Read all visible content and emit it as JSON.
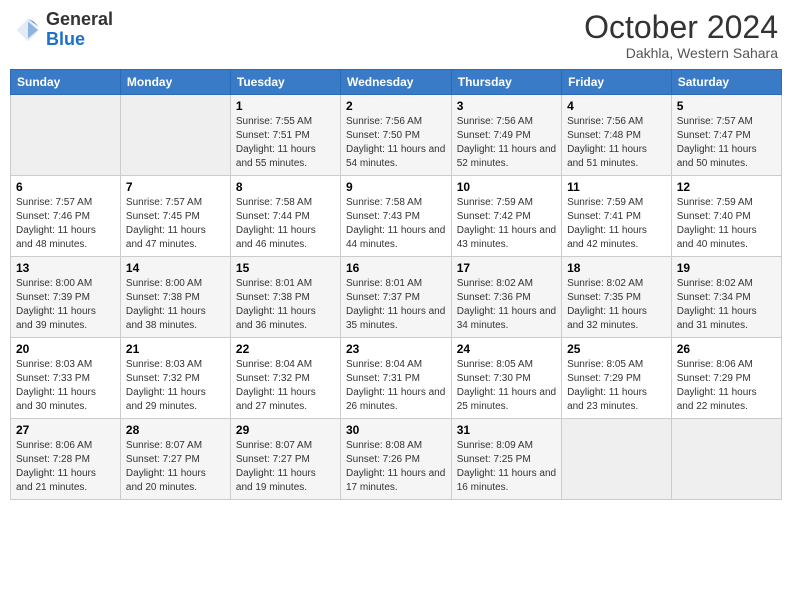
{
  "header": {
    "logo_general": "General",
    "logo_blue": "Blue",
    "month_title": "October 2024",
    "location": "Dakhla, Western Sahara"
  },
  "days_of_week": [
    "Sunday",
    "Monday",
    "Tuesday",
    "Wednesday",
    "Thursday",
    "Friday",
    "Saturday"
  ],
  "weeks": [
    [
      {
        "day": "",
        "sunrise": "",
        "sunset": "",
        "daylight": ""
      },
      {
        "day": "",
        "sunrise": "",
        "sunset": "",
        "daylight": ""
      },
      {
        "day": "1",
        "sunrise": "Sunrise: 7:55 AM",
        "sunset": "Sunset: 7:51 PM",
        "daylight": "Daylight: 11 hours and 55 minutes."
      },
      {
        "day": "2",
        "sunrise": "Sunrise: 7:56 AM",
        "sunset": "Sunset: 7:50 PM",
        "daylight": "Daylight: 11 hours and 54 minutes."
      },
      {
        "day": "3",
        "sunrise": "Sunrise: 7:56 AM",
        "sunset": "Sunset: 7:49 PM",
        "daylight": "Daylight: 11 hours and 52 minutes."
      },
      {
        "day": "4",
        "sunrise": "Sunrise: 7:56 AM",
        "sunset": "Sunset: 7:48 PM",
        "daylight": "Daylight: 11 hours and 51 minutes."
      },
      {
        "day": "5",
        "sunrise": "Sunrise: 7:57 AM",
        "sunset": "Sunset: 7:47 PM",
        "daylight": "Daylight: 11 hours and 50 minutes."
      }
    ],
    [
      {
        "day": "6",
        "sunrise": "Sunrise: 7:57 AM",
        "sunset": "Sunset: 7:46 PM",
        "daylight": "Daylight: 11 hours and 48 minutes."
      },
      {
        "day": "7",
        "sunrise": "Sunrise: 7:57 AM",
        "sunset": "Sunset: 7:45 PM",
        "daylight": "Daylight: 11 hours and 47 minutes."
      },
      {
        "day": "8",
        "sunrise": "Sunrise: 7:58 AM",
        "sunset": "Sunset: 7:44 PM",
        "daylight": "Daylight: 11 hours and 46 minutes."
      },
      {
        "day": "9",
        "sunrise": "Sunrise: 7:58 AM",
        "sunset": "Sunset: 7:43 PM",
        "daylight": "Daylight: 11 hours and 44 minutes."
      },
      {
        "day": "10",
        "sunrise": "Sunrise: 7:59 AM",
        "sunset": "Sunset: 7:42 PM",
        "daylight": "Daylight: 11 hours and 43 minutes."
      },
      {
        "day": "11",
        "sunrise": "Sunrise: 7:59 AM",
        "sunset": "Sunset: 7:41 PM",
        "daylight": "Daylight: 11 hours and 42 minutes."
      },
      {
        "day": "12",
        "sunrise": "Sunrise: 7:59 AM",
        "sunset": "Sunset: 7:40 PM",
        "daylight": "Daylight: 11 hours and 40 minutes."
      }
    ],
    [
      {
        "day": "13",
        "sunrise": "Sunrise: 8:00 AM",
        "sunset": "Sunset: 7:39 PM",
        "daylight": "Daylight: 11 hours and 39 minutes."
      },
      {
        "day": "14",
        "sunrise": "Sunrise: 8:00 AM",
        "sunset": "Sunset: 7:38 PM",
        "daylight": "Daylight: 11 hours and 38 minutes."
      },
      {
        "day": "15",
        "sunrise": "Sunrise: 8:01 AM",
        "sunset": "Sunset: 7:38 PM",
        "daylight": "Daylight: 11 hours and 36 minutes."
      },
      {
        "day": "16",
        "sunrise": "Sunrise: 8:01 AM",
        "sunset": "Sunset: 7:37 PM",
        "daylight": "Daylight: 11 hours and 35 minutes."
      },
      {
        "day": "17",
        "sunrise": "Sunrise: 8:02 AM",
        "sunset": "Sunset: 7:36 PM",
        "daylight": "Daylight: 11 hours and 34 minutes."
      },
      {
        "day": "18",
        "sunrise": "Sunrise: 8:02 AM",
        "sunset": "Sunset: 7:35 PM",
        "daylight": "Daylight: 11 hours and 32 minutes."
      },
      {
        "day": "19",
        "sunrise": "Sunrise: 8:02 AM",
        "sunset": "Sunset: 7:34 PM",
        "daylight": "Daylight: 11 hours and 31 minutes."
      }
    ],
    [
      {
        "day": "20",
        "sunrise": "Sunrise: 8:03 AM",
        "sunset": "Sunset: 7:33 PM",
        "daylight": "Daylight: 11 hours and 30 minutes."
      },
      {
        "day": "21",
        "sunrise": "Sunrise: 8:03 AM",
        "sunset": "Sunset: 7:32 PM",
        "daylight": "Daylight: 11 hours and 29 minutes."
      },
      {
        "day": "22",
        "sunrise": "Sunrise: 8:04 AM",
        "sunset": "Sunset: 7:32 PM",
        "daylight": "Daylight: 11 hours and 27 minutes."
      },
      {
        "day": "23",
        "sunrise": "Sunrise: 8:04 AM",
        "sunset": "Sunset: 7:31 PM",
        "daylight": "Daylight: 11 hours and 26 minutes."
      },
      {
        "day": "24",
        "sunrise": "Sunrise: 8:05 AM",
        "sunset": "Sunset: 7:30 PM",
        "daylight": "Daylight: 11 hours and 25 minutes."
      },
      {
        "day": "25",
        "sunrise": "Sunrise: 8:05 AM",
        "sunset": "Sunset: 7:29 PM",
        "daylight": "Daylight: 11 hours and 23 minutes."
      },
      {
        "day": "26",
        "sunrise": "Sunrise: 8:06 AM",
        "sunset": "Sunset: 7:29 PM",
        "daylight": "Daylight: 11 hours and 22 minutes."
      }
    ],
    [
      {
        "day": "27",
        "sunrise": "Sunrise: 8:06 AM",
        "sunset": "Sunset: 7:28 PM",
        "daylight": "Daylight: 11 hours and 21 minutes."
      },
      {
        "day": "28",
        "sunrise": "Sunrise: 8:07 AM",
        "sunset": "Sunset: 7:27 PM",
        "daylight": "Daylight: 11 hours and 20 minutes."
      },
      {
        "day": "29",
        "sunrise": "Sunrise: 8:07 AM",
        "sunset": "Sunset: 7:27 PM",
        "daylight": "Daylight: 11 hours and 19 minutes."
      },
      {
        "day": "30",
        "sunrise": "Sunrise: 8:08 AM",
        "sunset": "Sunset: 7:26 PM",
        "daylight": "Daylight: 11 hours and 17 minutes."
      },
      {
        "day": "31",
        "sunrise": "Sunrise: 8:09 AM",
        "sunset": "Sunset: 7:25 PM",
        "daylight": "Daylight: 11 hours and 16 minutes."
      },
      {
        "day": "",
        "sunrise": "",
        "sunset": "",
        "daylight": ""
      },
      {
        "day": "",
        "sunrise": "",
        "sunset": "",
        "daylight": ""
      }
    ]
  ]
}
